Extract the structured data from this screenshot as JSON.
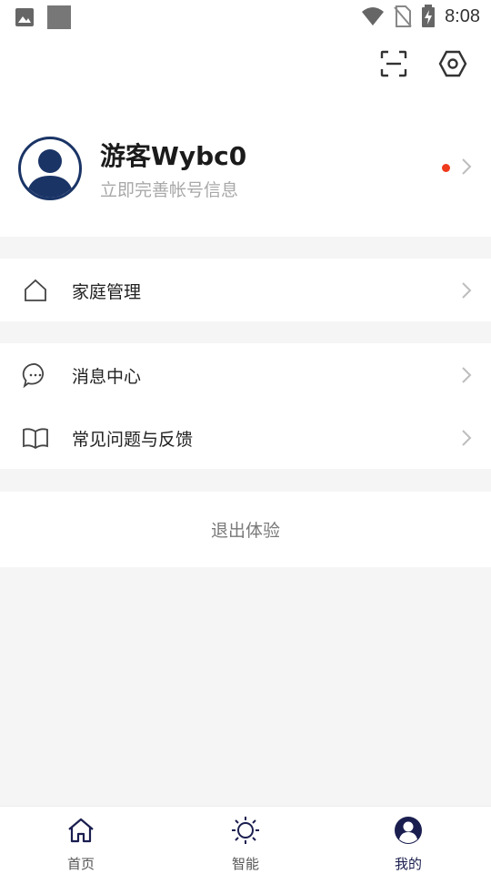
{
  "status_bar": {
    "time": "8:08"
  },
  "profile": {
    "name": "游客Wybc0",
    "subtitle": "立即完善帐号信息"
  },
  "menu_group1": [
    {
      "label": "家庭管理",
      "icon": "home-outline-icon"
    }
  ],
  "menu_group2": [
    {
      "label": "消息中心",
      "icon": "chat-bubble-icon"
    },
    {
      "label": "常见问题与反馈",
      "icon": "book-icon"
    }
  ],
  "logout_label": "退出体验",
  "tabs": [
    {
      "label": "首页",
      "icon": "home-icon"
    },
    {
      "label": "智能",
      "icon": "sun-icon"
    },
    {
      "label": "我的",
      "icon": "user-icon"
    }
  ],
  "colors": {
    "accent": "#1a3466",
    "badge": "#ee3a1c",
    "active_tab": "#1a1e4f"
  }
}
